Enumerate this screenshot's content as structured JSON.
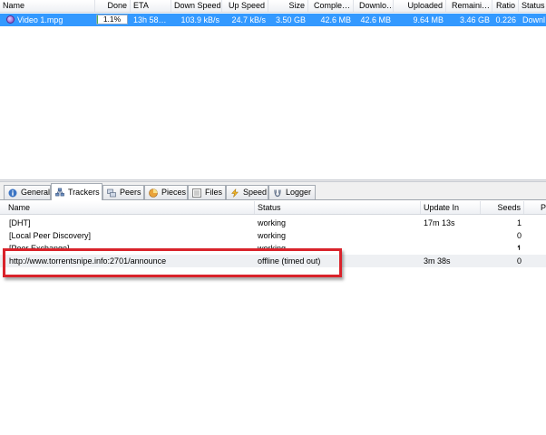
{
  "torrent_columns": [
    "Name",
    "Done",
    "ETA",
    "Down Speed",
    "Up Speed",
    "Size",
    "Comple…",
    "Downlo…",
    "Uploaded",
    "Remaini…",
    "Ratio",
    "Status"
  ],
  "torrent": {
    "name": "Video 1.mpg",
    "done": "1.1%",
    "done_fraction": 0.011,
    "eta": "13h 58…",
    "down_speed": "103.9 kB/s",
    "up_speed": "24.7 kB/s",
    "size": "3.50 GB",
    "completed": "42.6 MB",
    "downloaded": "42.6 MB",
    "uploaded": "9.64 MB",
    "remaining": "3.46 GB",
    "ratio": "0.226",
    "status": "Downl"
  },
  "tabs": [
    {
      "label": "General",
      "icon": "info-icon"
    },
    {
      "label": "Trackers",
      "icon": "trackers-icon",
      "active": true
    },
    {
      "label": "Peers",
      "icon": "peers-icon"
    },
    {
      "label": "Pieces",
      "icon": "pieces-icon"
    },
    {
      "label": "Files",
      "icon": "files-icon"
    },
    {
      "label": "Speed",
      "icon": "speed-icon"
    },
    {
      "label": "Logger",
      "icon": "logger-icon"
    }
  ],
  "tracker_columns": {
    "name": "Name",
    "status": "Status",
    "update_in": "Update In",
    "seeds": "Seeds",
    "peers": "P"
  },
  "trackers": [
    {
      "name": "[DHT]",
      "status": "working",
      "update_in": "17m 13s",
      "seeds": "1"
    },
    {
      "name": "[Local Peer Discovery]",
      "status": "working",
      "update_in": "",
      "seeds": "0"
    },
    {
      "name": "[Peer Exchange]",
      "status": "working",
      "update_in": "",
      "seeds": "1"
    },
    {
      "name": "http://www.torrentsnipe.info:2701/announce",
      "status": "offline (timed out)",
      "update_in": "3m 38s",
      "seeds": "0"
    }
  ],
  "colors": {
    "selection": "#3399ff",
    "highlight_box": "#d9232b"
  }
}
